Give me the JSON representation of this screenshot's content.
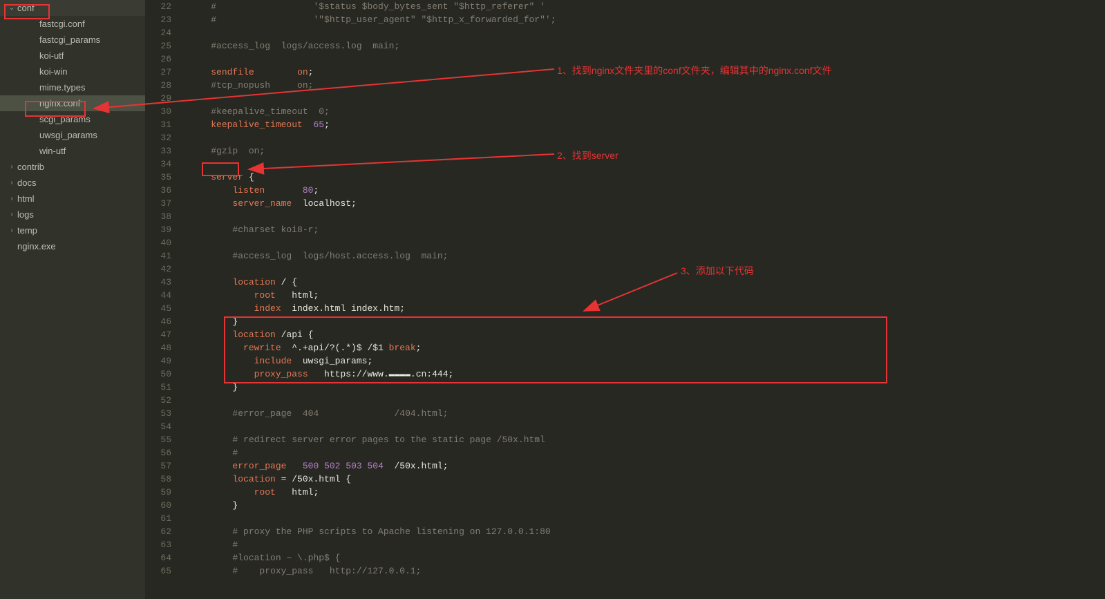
{
  "sidebar": {
    "items": [
      {
        "label": "conf",
        "depth": 1,
        "expand": "open",
        "box": true
      },
      {
        "label": "fastcgi.conf",
        "depth": 2
      },
      {
        "label": "fastcgi_params",
        "depth": 2
      },
      {
        "label": "koi-utf",
        "depth": 2
      },
      {
        "label": "koi-win",
        "depth": 2
      },
      {
        "label": "mime.types",
        "depth": 2
      },
      {
        "label": "nginx.conf",
        "depth": 2,
        "selected": true,
        "box": true
      },
      {
        "label": "scgi_params",
        "depth": 2
      },
      {
        "label": "uwsgi_params",
        "depth": 2
      },
      {
        "label": "win-utf",
        "depth": 2
      },
      {
        "label": "contrib",
        "depth": 1,
        "expand": "closed"
      },
      {
        "label": "docs",
        "depth": 1,
        "expand": "closed"
      },
      {
        "label": "html",
        "depth": 1,
        "expand": "closed"
      },
      {
        "label": "logs",
        "depth": 1,
        "expand": "closed"
      },
      {
        "label": "temp",
        "depth": 1,
        "expand": "closed"
      },
      {
        "label": "nginx.exe",
        "depth": 1
      }
    ]
  },
  "annotations": {
    "a1": "1、找到nginx文件夹里的conf文件夹，编辑其中的nginx.conf文件",
    "a2": "2、找到server",
    "a3": "3、添加以下代码"
  },
  "editor": {
    "startLine": 22,
    "lines": [
      {
        "n": 22,
        "spans": [
          [
            "c-comment",
            "#                  '$status $body_bytes_sent \"$http_referer\" '"
          ]
        ],
        "ind": 4
      },
      {
        "n": 23,
        "spans": [
          [
            "c-comment",
            "#                  '\"$http_user_agent\" \"$http_x_forwarded_for\"';"
          ]
        ],
        "ind": 4
      },
      {
        "n": 24,
        "spans": [],
        "ind": 4
      },
      {
        "n": 25,
        "spans": [
          [
            "c-comment",
            "#access_log  logs/access.log  main;"
          ]
        ],
        "ind": 4
      },
      {
        "n": 26,
        "spans": [],
        "ind": 4
      },
      {
        "n": 27,
        "spans": [
          [
            "c-kw",
            "sendfile"
          ],
          [
            "c-plain",
            "        "
          ],
          [
            "c-kw",
            "on"
          ],
          [
            "c-plain",
            ";"
          ]
        ],
        "ind": 4
      },
      {
        "n": 28,
        "spans": [
          [
            "c-comment",
            "#tcp_nopush     on;"
          ]
        ],
        "ind": 4
      },
      {
        "n": 29,
        "spans": [],
        "ind": 4
      },
      {
        "n": 30,
        "spans": [
          [
            "c-comment",
            "#keepalive_timeout  0;"
          ]
        ],
        "ind": 4
      },
      {
        "n": 31,
        "spans": [
          [
            "c-kw",
            "keepalive_timeout"
          ],
          [
            "c-plain",
            "  "
          ],
          [
            "c-num",
            "65"
          ],
          [
            "c-plain",
            ";"
          ]
        ],
        "ind": 4
      },
      {
        "n": 32,
        "spans": [],
        "ind": 4
      },
      {
        "n": 33,
        "spans": [
          [
            "c-comment",
            "#gzip  on;"
          ]
        ],
        "ind": 4
      },
      {
        "n": 34,
        "spans": [],
        "ind": 4
      },
      {
        "n": 35,
        "spans": [
          [
            "c-kw",
            "server"
          ],
          [
            "c-plain",
            " {"
          ]
        ],
        "ind": 4
      },
      {
        "n": 36,
        "spans": [
          [
            "c-kw",
            "listen"
          ],
          [
            "c-plain",
            "       "
          ],
          [
            "c-num",
            "80"
          ],
          [
            "c-plain",
            ";"
          ]
        ],
        "ind": 8
      },
      {
        "n": 37,
        "spans": [
          [
            "c-kw",
            "server_name"
          ],
          [
            "c-plain",
            "  localhost;"
          ]
        ],
        "ind": 8
      },
      {
        "n": 38,
        "spans": [],
        "ind": 8
      },
      {
        "n": 39,
        "spans": [
          [
            "c-comment",
            "#charset koi8-r;"
          ]
        ],
        "ind": 8
      },
      {
        "n": 40,
        "spans": [],
        "ind": 8
      },
      {
        "n": 41,
        "spans": [
          [
            "c-comment",
            "#access_log  logs/host.access.log  main;"
          ]
        ],
        "ind": 8
      },
      {
        "n": 42,
        "spans": [],
        "ind": 8
      },
      {
        "n": 43,
        "spans": [
          [
            "c-kw",
            "location"
          ],
          [
            "c-plain",
            " / {"
          ]
        ],
        "ind": 8
      },
      {
        "n": 44,
        "spans": [
          [
            "c-kw",
            "root"
          ],
          [
            "c-plain",
            "   html;"
          ]
        ],
        "ind": 12
      },
      {
        "n": 45,
        "spans": [
          [
            "c-kw",
            "index"
          ],
          [
            "c-plain",
            "  index.html index.htm;"
          ]
        ],
        "ind": 12
      },
      {
        "n": 46,
        "spans": [
          [
            "c-plain",
            "}"
          ]
        ],
        "ind": 8
      },
      {
        "n": 47,
        "spans": [
          [
            "c-kw",
            "location"
          ],
          [
            "c-plain",
            " /api {"
          ]
        ],
        "ind": 8
      },
      {
        "n": 48,
        "spans": [
          [
            "c-kw",
            "rewrite"
          ],
          [
            "c-plain",
            "  ^.+api/?(.*)$ /$1 "
          ],
          [
            "c-kw",
            "break"
          ],
          [
            "c-plain",
            ";"
          ]
        ],
        "ind": 10
      },
      {
        "n": 49,
        "spans": [
          [
            "c-kw",
            "include"
          ],
          [
            "c-plain",
            "  uwsgi_params;"
          ]
        ],
        "ind": 12
      },
      {
        "n": 50,
        "spans": [
          [
            "c-kw",
            "proxy_pass"
          ],
          [
            "c-plain",
            "   https://www."
          ],
          [
            "c-plain",
            "▬▬▬▬"
          ],
          [
            "c-plain",
            ".cn:444;"
          ]
        ],
        "ind": 12
      },
      {
        "n": 51,
        "spans": [
          [
            "c-plain",
            "}"
          ]
        ],
        "ind": 8
      },
      {
        "n": 52,
        "spans": [],
        "ind": 8
      },
      {
        "n": 53,
        "spans": [
          [
            "c-comment",
            "#error_page  404              /404.html;"
          ]
        ],
        "ind": 8
      },
      {
        "n": 54,
        "spans": [],
        "ind": 8
      },
      {
        "n": 55,
        "spans": [
          [
            "c-comment",
            "# redirect server error pages to the static page /50x.html"
          ]
        ],
        "ind": 8
      },
      {
        "n": 56,
        "spans": [
          [
            "c-comment",
            "#"
          ]
        ],
        "ind": 8
      },
      {
        "n": 57,
        "spans": [
          [
            "c-kw",
            "error_page"
          ],
          [
            "c-plain",
            "   "
          ],
          [
            "c-num",
            "500"
          ],
          [
            "c-plain",
            " "
          ],
          [
            "c-num",
            "502"
          ],
          [
            "c-plain",
            " "
          ],
          [
            "c-num",
            "503"
          ],
          [
            "c-plain",
            " "
          ],
          [
            "c-num",
            "504"
          ],
          [
            "c-plain",
            "  /50x.html;"
          ]
        ],
        "ind": 8
      },
      {
        "n": 58,
        "spans": [
          [
            "c-kw",
            "location"
          ],
          [
            "c-plain",
            " = /50x.html {"
          ]
        ],
        "ind": 8
      },
      {
        "n": 59,
        "spans": [
          [
            "c-kw",
            "root"
          ],
          [
            "c-plain",
            "   html;"
          ]
        ],
        "ind": 12
      },
      {
        "n": 60,
        "spans": [
          [
            "c-plain",
            "}"
          ]
        ],
        "ind": 8
      },
      {
        "n": 61,
        "spans": [],
        "ind": 8
      },
      {
        "n": 62,
        "spans": [
          [
            "c-comment",
            "# proxy the PHP scripts to Apache listening on 127.0.0.1:80"
          ]
        ],
        "ind": 8
      },
      {
        "n": 63,
        "spans": [
          [
            "c-comment",
            "#"
          ]
        ],
        "ind": 8
      },
      {
        "n": 64,
        "spans": [
          [
            "c-comment",
            "#location ~ \\.php$ {"
          ]
        ],
        "ind": 8
      },
      {
        "n": 65,
        "spans": [
          [
            "c-comment",
            "#    proxy_pass   http://127.0.0.1;"
          ]
        ],
        "ind": 8
      }
    ]
  }
}
